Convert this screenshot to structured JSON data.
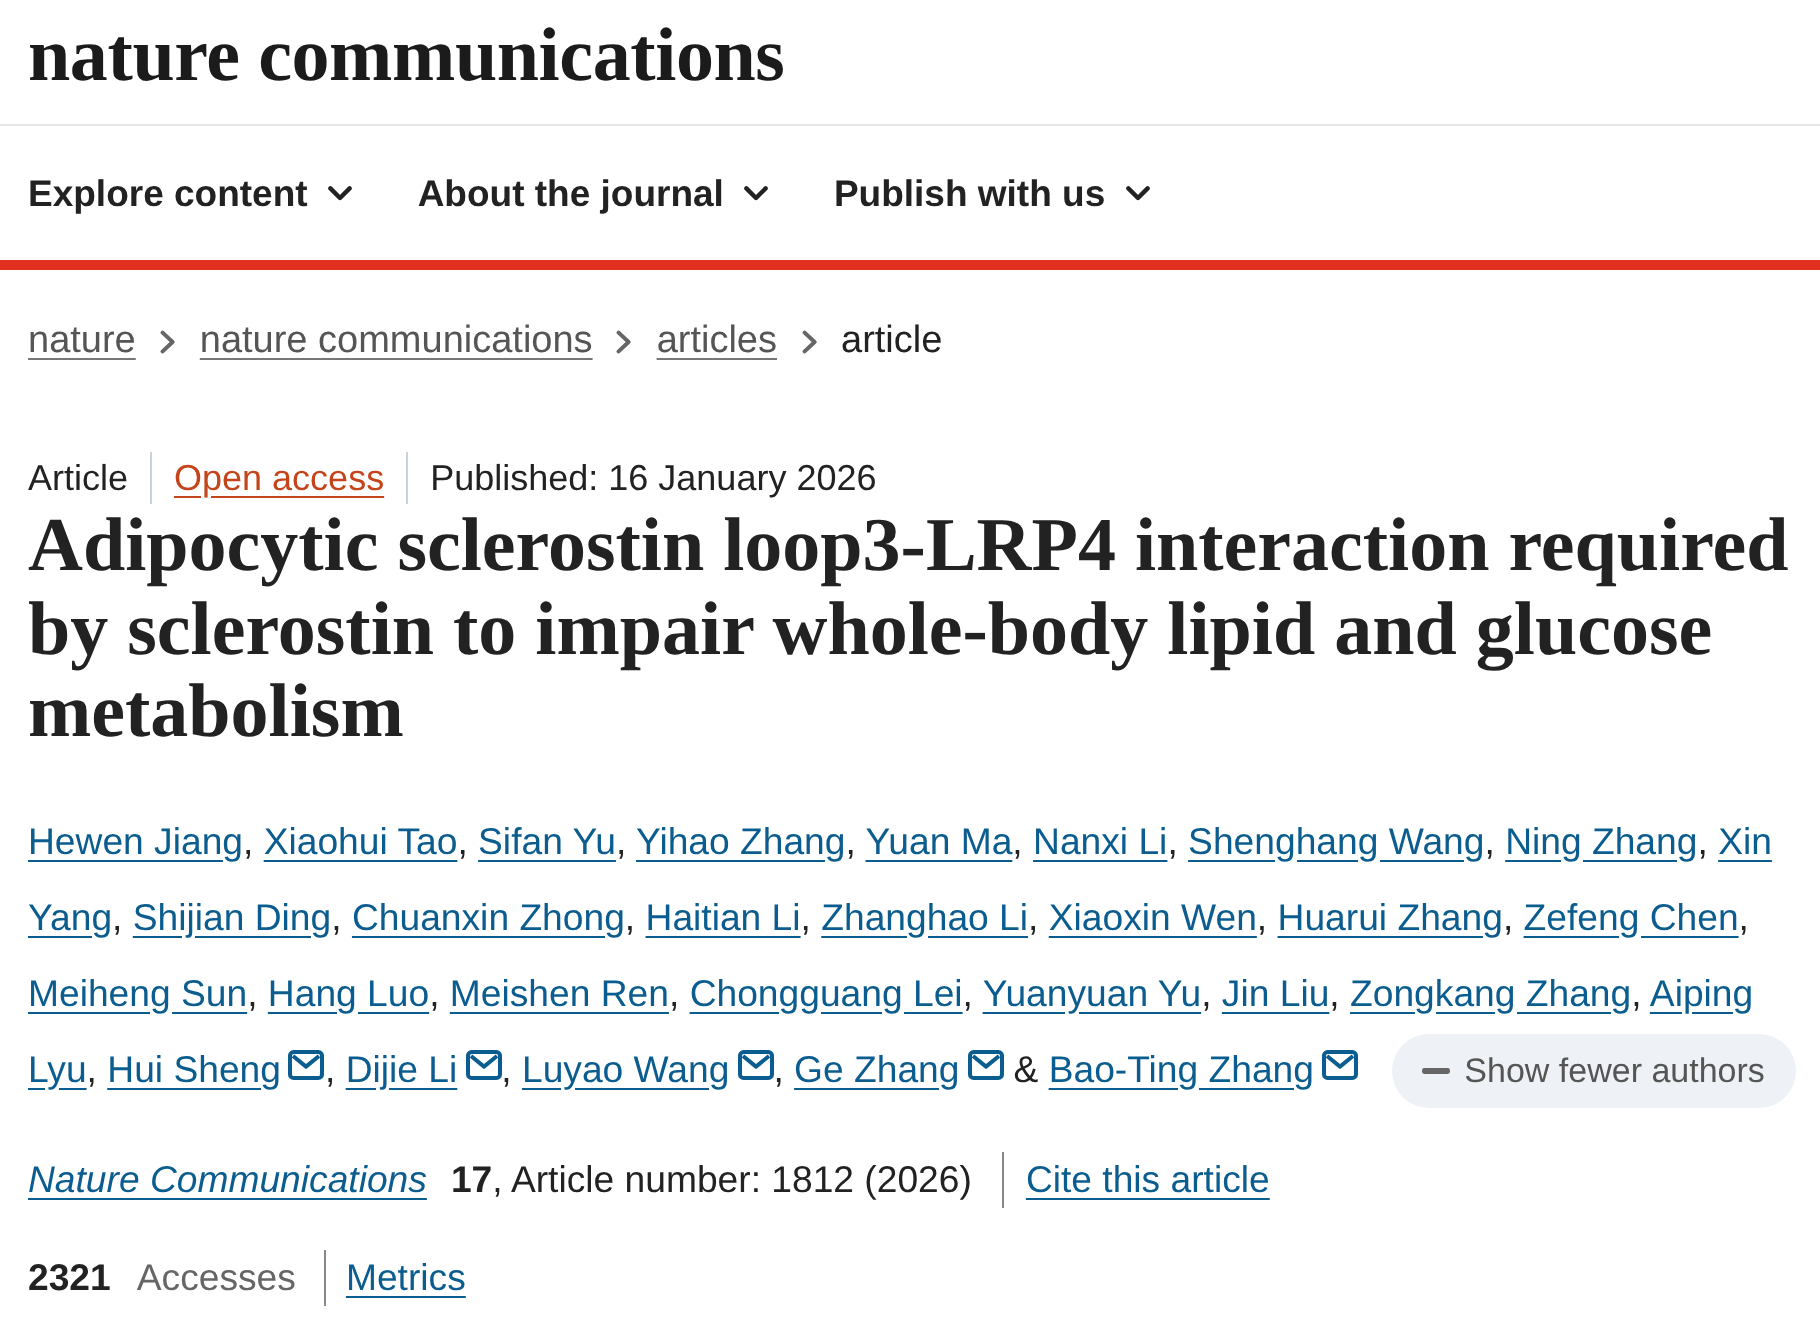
{
  "masthead": {
    "logo": "nature communications",
    "nav": [
      {
        "label": "Explore content"
      },
      {
        "label": "About the journal"
      },
      {
        "label": "Publish with us"
      }
    ]
  },
  "breadcrumbs": [
    {
      "label": "nature",
      "kind": "link"
    },
    {
      "label": "nature communications",
      "kind": "link"
    },
    {
      "label": "articles",
      "kind": "link"
    },
    {
      "label": "article",
      "kind": "current"
    }
  ],
  "article": {
    "type": "Article",
    "access": "Open access",
    "published": "Published: 16 January 2026",
    "title": "Adipocytic sclerostin loop3-LRP4 interaction required by sclerostin to impair whole-body lipid and glucose metabolism",
    "authors": [
      {
        "name": "Hewen Jiang",
        "corresponding": false,
        "separator": ","
      },
      {
        "name": "Xiaohui Tao",
        "corresponding": false,
        "separator": ","
      },
      {
        "name": "Sifan Yu",
        "corresponding": false,
        "separator": ","
      },
      {
        "name": "Yihao Zhang",
        "corresponding": false,
        "separator": ","
      },
      {
        "name": "Yuan Ma",
        "corresponding": false,
        "separator": ","
      },
      {
        "name": "Nanxi Li",
        "corresponding": false,
        "separator": ","
      },
      {
        "name": "Shenghang Wang",
        "corresponding": false,
        "separator": ","
      },
      {
        "name": "Ning Zhang",
        "corresponding": false,
        "separator": ","
      },
      {
        "name": "Xin Yang",
        "corresponding": false,
        "separator": ","
      },
      {
        "name": "Shijian Ding",
        "corresponding": false,
        "separator": ","
      },
      {
        "name": "Chuanxin Zhong",
        "corresponding": false,
        "separator": ","
      },
      {
        "name": "Haitian Li",
        "corresponding": false,
        "separator": ","
      },
      {
        "name": "Zhanghao Li",
        "corresponding": false,
        "separator": ","
      },
      {
        "name": "Xiaoxin Wen",
        "corresponding": false,
        "separator": ","
      },
      {
        "name": "Huarui Zhang",
        "corresponding": false,
        "separator": ","
      },
      {
        "name": "Zefeng Chen",
        "corresponding": false,
        "separator": ","
      },
      {
        "name": "Meiheng Sun",
        "corresponding": false,
        "separator": ","
      },
      {
        "name": "Hang Luo",
        "corresponding": false,
        "separator": ","
      },
      {
        "name": "Meishen Ren",
        "corresponding": false,
        "separator": ","
      },
      {
        "name": "Chongguang Lei",
        "corresponding": false,
        "separator": ","
      },
      {
        "name": "Yuanyuan Yu",
        "corresponding": false,
        "separator": ","
      },
      {
        "name": "Jin Liu",
        "corresponding": false,
        "separator": ","
      },
      {
        "name": "Zongkang Zhang",
        "corresponding": false,
        "separator": ","
      },
      {
        "name": "Aiping Lyu",
        "corresponding": false,
        "separator": ","
      },
      {
        "name": "Hui Sheng",
        "corresponding": true,
        "separator": ","
      },
      {
        "name": "Dijie Li",
        "corresponding": true,
        "separator": ","
      },
      {
        "name": "Luyao Wang",
        "corresponding": true,
        "separator": ","
      },
      {
        "name": "Ge Zhang",
        "corresponding": true,
        "separator": "&"
      },
      {
        "name": "Bao-Ting Zhang",
        "corresponding": true
      }
    ],
    "authors_toggle": "Show fewer authors",
    "journal": "Nature Communications",
    "citation": "**17**, Article number: 1812 (2026)",
    "cite_link": "Cite this article",
    "metrics": {
      "count": "2321",
      "label": "Accesses",
      "link": "Metrics"
    }
  }
}
